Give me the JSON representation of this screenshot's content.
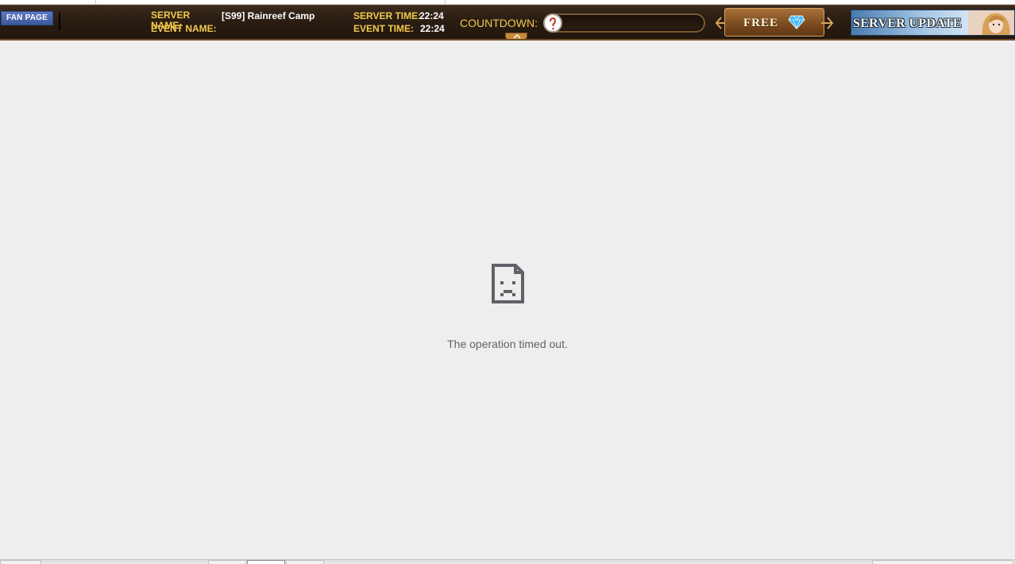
{
  "gamebar": {
    "fan_page_label": "FAN PAGE",
    "server_name_label": "SERVER NAME:",
    "server_name_value": "[S99] Rainreef Camp",
    "event_name_label": "EVENT NAME:",
    "event_name_value": "",
    "server_time_label": "SERVER TIME:",
    "server_time_value": "22:24",
    "event_time_label": "EVENT TIME:",
    "event_time_value": "22:24",
    "countdown_label": "COUNTDOWN:",
    "free_label": "FREE",
    "server_update_label": "SERVER UPDATE"
  },
  "main": {
    "error_message": "The operation timed out."
  },
  "colors": {
    "label_gold": "#f2c94c",
    "bar_brown": "#2a1d12",
    "page_background": "#eeeeee",
    "error_text": "#646464",
    "fan_page_blue": "#3b5998"
  }
}
